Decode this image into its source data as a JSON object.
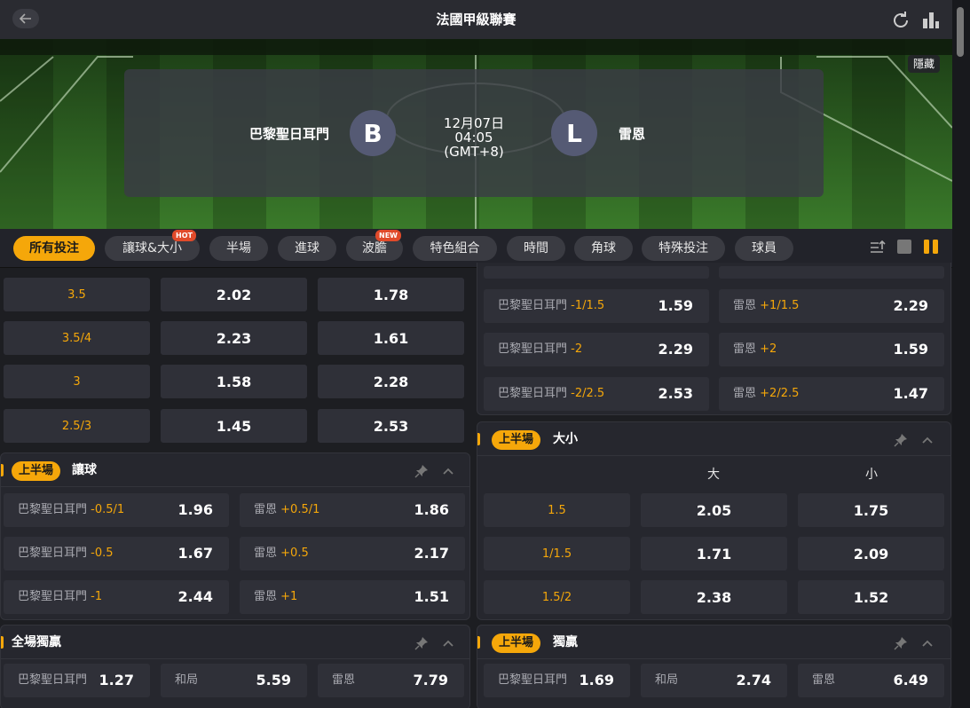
{
  "header": {
    "title": "法國甲級聯賽",
    "back_icon": "arrow-left-icon",
    "refresh_icon": "refresh-icon",
    "stats_icon": "bar-chart-icon"
  },
  "match": {
    "home_name": "巴黎聖日耳門",
    "home_badge": "B",
    "away_name": "雷恩",
    "away_badge": "L",
    "date": "12月07日",
    "time": "04:05",
    "tz": "(GMT+8)",
    "hide_label": "隱藏"
  },
  "filters": {
    "items": [
      "所有投注",
      "讓球&大小",
      "半場",
      "進球",
      "波膽",
      "特色組合",
      "時間",
      "角球",
      "特殊投注",
      "球員"
    ],
    "hot": "HOT",
    "new": "NEW"
  },
  "ou_top": {
    "rows": [
      {
        "line": "3.5",
        "over": "2.02",
        "under": "1.78"
      },
      {
        "line": "3.5/4",
        "over": "2.23",
        "under": "1.61"
      },
      {
        "line": "3",
        "over": "1.58",
        "under": "2.28"
      },
      {
        "line": "2.5/3",
        "over": "1.45",
        "under": "2.53"
      }
    ]
  },
  "hdp_top": {
    "rows": [
      {
        "home": "巴黎聖日耳門",
        "home_hc": "-1/1.5",
        "home_odd": "1.59",
        "away": "雷恩",
        "away_hc": "+1/1.5",
        "away_odd": "2.29"
      },
      {
        "home": "巴黎聖日耳門",
        "home_hc": "-2",
        "home_odd": "2.29",
        "away": "雷恩",
        "away_hc": "+2",
        "away_odd": "1.59"
      },
      {
        "home": "巴黎聖日耳門",
        "home_hc": "-2/2.5",
        "home_odd": "2.53",
        "away": "雷恩",
        "away_hc": "+2/2.5",
        "away_odd": "1.47"
      }
    ]
  },
  "fh_hdp": {
    "badge": "上半場",
    "title": "讓球",
    "rows": [
      {
        "home": "巴黎聖日耳門",
        "home_hc": "-0.5/1",
        "home_odd": "1.96",
        "away": "雷恩",
        "away_hc": "+0.5/1",
        "away_odd": "1.86"
      },
      {
        "home": "巴黎聖日耳門",
        "home_hc": "-0.5",
        "home_odd": "1.67",
        "away": "雷恩",
        "away_hc": "+0.5",
        "away_odd": "2.17"
      },
      {
        "home": "巴黎聖日耳門",
        "home_hc": "-1",
        "home_odd": "2.44",
        "away": "雷恩",
        "away_hc": "+1",
        "away_odd": "1.51"
      }
    ]
  },
  "fh_ou": {
    "badge": "上半場",
    "title": "大小",
    "over_label": "大",
    "under_label": "小",
    "rows": [
      {
        "line": "1.5",
        "over": "2.05",
        "under": "1.75"
      },
      {
        "line": "1/1.5",
        "over": "1.71",
        "under": "2.09"
      },
      {
        "line": "1.5/2",
        "over": "2.38",
        "under": "1.52"
      }
    ]
  },
  "ft_1x2": {
    "title": "全場獨贏",
    "home": "巴黎聖日耳門",
    "home_odd": "1.27",
    "draw": "和局",
    "draw_odd": "5.59",
    "away": "雷恩",
    "away_odd": "7.79"
  },
  "fh_1x2": {
    "badge": "上半場",
    "title": "獨贏",
    "home": "巴黎聖日耳門",
    "home_odd": "1.69",
    "draw": "和局",
    "draw_odd": "2.74",
    "away": "雷恩",
    "away_odd": "6.49"
  },
  "colors": {
    "accent": "#f5a70a",
    "panel": "#26272e",
    "cell": "#2f3038"
  }
}
